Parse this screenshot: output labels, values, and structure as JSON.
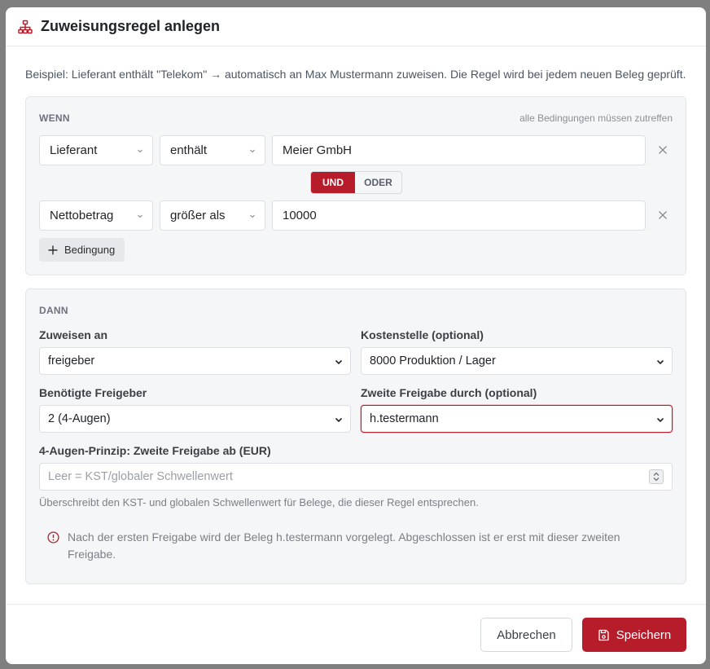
{
  "modal": {
    "title": "Zuweisungsregel anlegen",
    "title_icon": "sitemap-icon",
    "intro": "Beispiel: Lieferant enthält \"Telekom\" → automatisch an Max Mustermann zuweisen. Die Regel wird bei jedem neuen Beleg geprüft."
  },
  "wenn": {
    "label": "WENN",
    "hint": "alle Bedingungen müssen zutreffen",
    "conditions": [
      {
        "field": "Lieferant",
        "operator": "enthält",
        "value": "Meier GmbH"
      },
      {
        "field": "Nettobetrag",
        "operator": "größer als",
        "value": "10000"
      }
    ],
    "logic": {
      "options": [
        "UND",
        "ODER"
      ],
      "selected": "UND"
    },
    "add_condition": "Bedingung"
  },
  "dann": {
    "label": "DANN",
    "assign_label": "Zuweisen an",
    "assign_value": "freigeber",
    "cost_center_label": "Kostenstelle (optional)",
    "cost_center_value": "8000 Produktion / Lager",
    "approvers_label": "Benötigte Freigeber",
    "approvers_value": "2 (4-Augen)",
    "second_approval_label": "Zweite Freigabe durch (optional)",
    "second_approval_value": "h.testermann",
    "threshold_label": "4-Augen-Prinzip: Zweite Freigabe ab (EUR)",
    "threshold_placeholder": "Leer = KST/globaler Schwellenwert",
    "help_text": "Überschreibt den KST- und globalen Schwellenwert für Belege, die dieser Regel entsprechen.",
    "info_text": "Nach der ersten Freigabe wird der Beleg h.testermann vorgelegt. Abgeschlossen ist er erst mit dieser zweiten Freigabe."
  },
  "footer": {
    "cancel_label": "Abbrechen",
    "save_label": "Speichern"
  },
  "colors": {
    "accent": "#b71c2a",
    "panel_bg": "#f5f6f7"
  }
}
